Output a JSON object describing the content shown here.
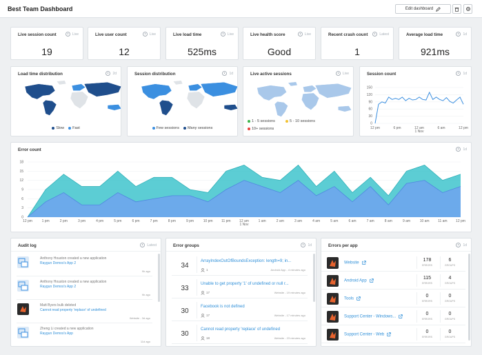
{
  "page": {
    "title": "Best Team Dashboard"
  },
  "toolbar": {
    "edit_label": "Edit dashboard"
  },
  "stats": [
    {
      "title": "Live session count",
      "range": "Live",
      "value": "19"
    },
    {
      "title": "Live user count",
      "range": "Live",
      "value": "12"
    },
    {
      "title": "Live load time",
      "range": "Live",
      "value": "525ms"
    },
    {
      "title": "Live health score",
      "range": "Live",
      "value": "Good"
    },
    {
      "title": "Recent crash count",
      "range": "Latest",
      "value": "1"
    },
    {
      "title": "Average load time",
      "range": "1d",
      "value": "921ms"
    }
  ],
  "maps": [
    {
      "title": "Load time distribution",
      "range": "2d",
      "legend": [
        "Slow",
        "Fast"
      ],
      "colors": [
        "#1f4e8c",
        "#3b8fe0"
      ]
    },
    {
      "title": "Session distribution",
      "range": "1d",
      "legend": [
        "Few sessions",
        "Many sessions"
      ],
      "colors": [
        "#3b8fe0",
        "#1f4e8c"
      ]
    },
    {
      "title": "Live active sessions",
      "range": "Live",
      "legend": [
        "1 - 5 sessions",
        "5 - 10 sessions",
        "10+ sessions"
      ],
      "colors": [
        "#3cb54a",
        "#f2c230",
        "#e8403a"
      ]
    }
  ],
  "session_count": {
    "title": "Session count",
    "range": "1d",
    "chart_data": {
      "type": "line",
      "ylim": [
        0,
        150
      ],
      "yticks": [
        "150",
        "120",
        "90",
        "60",
        "30",
        "0"
      ],
      "xticks": [
        "12 pm",
        "6 pm",
        "12 am",
        "6 am",
        "12 pm"
      ],
      "xsub": "1 Nov",
      "values": [
        0,
        80,
        90,
        85,
        110,
        100,
        105,
        100,
        110,
        95,
        105,
        98,
        100,
        110,
        100,
        98,
        130,
        100,
        110,
        100,
        95,
        108,
        92,
        85,
        98,
        110,
        80
      ]
    }
  },
  "error_count": {
    "title": "Error count",
    "range": "1d",
    "chart_data": {
      "type": "area",
      "ylim": [
        0,
        18
      ],
      "yticks": [
        "18",
        "15",
        "12",
        "9",
        "6",
        "3",
        "0"
      ],
      "xticks": [
        "12 pm",
        "1 pm",
        "2 pm",
        "3 pm",
        "4 pm",
        "5 pm",
        "6 pm",
        "7 pm",
        "8 pm",
        "9 pm",
        "10 pm",
        "11 pm",
        "12 am",
        "1 am",
        "2 am",
        "3 am",
        "4 am",
        "5 am",
        "6 am",
        "7 am",
        "8 am",
        "9 am",
        "10 am",
        "11 am",
        "12 pm"
      ],
      "xsub": "1 Nov",
      "series": [
        {
          "values": [
            0,
            9,
            14,
            10,
            10,
            15,
            10,
            13,
            13,
            9,
            8,
            15,
            17,
            13,
            12,
            17,
            10,
            15,
            8,
            13,
            7,
            15,
            17,
            12,
            14
          ],
          "color": "#40c4cc"
        },
        {
          "values": [
            0,
            5,
            8,
            4,
            4,
            8,
            5,
            6,
            7,
            7,
            5,
            9,
            12,
            10,
            8,
            12,
            7,
            10,
            5,
            10,
            4,
            11,
            12,
            8,
            10
          ],
          "color": "#6ea3ee"
        }
      ]
    }
  },
  "audit": {
    "title": "Audit log",
    "range": "Latest",
    "items": [
      {
        "name": "Anthony Houston created a new application",
        "link": "Raygun Demos's App 2",
        "time": "9h ago"
      },
      {
        "name": "Anthony Houston created a new application",
        "link": "Raygun Demos's App 2",
        "time": "9h ago"
      },
      {
        "name": "Matt Byers bulk deleted",
        "link": "Cannot read property 'replace' of undefined",
        "time": "Website - 3d ago"
      },
      {
        "name": "Zheng Li created a new application",
        "link": "Raygun Demos's App",
        "time": "11d ago"
      }
    ]
  },
  "errors": {
    "title": "Error groups",
    "range": "1d",
    "items": [
      {
        "count": "34",
        "title": "ArrayIndexOutOfBoundsException: length=9; in...",
        "users": "1",
        "meta": "Android App - 4 minutes ago"
      },
      {
        "count": "33",
        "title": "Unable to get property '1' of undefined or null r...",
        "users": "17",
        "meta": "Website - 19 minutes ago"
      },
      {
        "count": "30",
        "title": "Facebook is not defined",
        "users": "17",
        "meta": "Website - 17 minutes ago"
      },
      {
        "count": "30",
        "title": "Cannot read property 'replace' of undefined",
        "users": "18",
        "meta": "Website - 23 minutes ago"
      }
    ]
  },
  "apps": {
    "title": "Errors per app",
    "range": "1d",
    "errors_label": "ERRORS",
    "groups_label": "GROUPS",
    "items": [
      {
        "name": "Website",
        "errors": "178",
        "groups": "6"
      },
      {
        "name": "Android App",
        "errors": "115",
        "groups": "4"
      },
      {
        "name": "Tools",
        "errors": "0",
        "groups": "0"
      },
      {
        "name": "Support Center - Windows...",
        "errors": "0",
        "groups": "0"
      },
      {
        "name": "Support Center - Web",
        "errors": "0",
        "groups": "0"
      }
    ]
  }
}
